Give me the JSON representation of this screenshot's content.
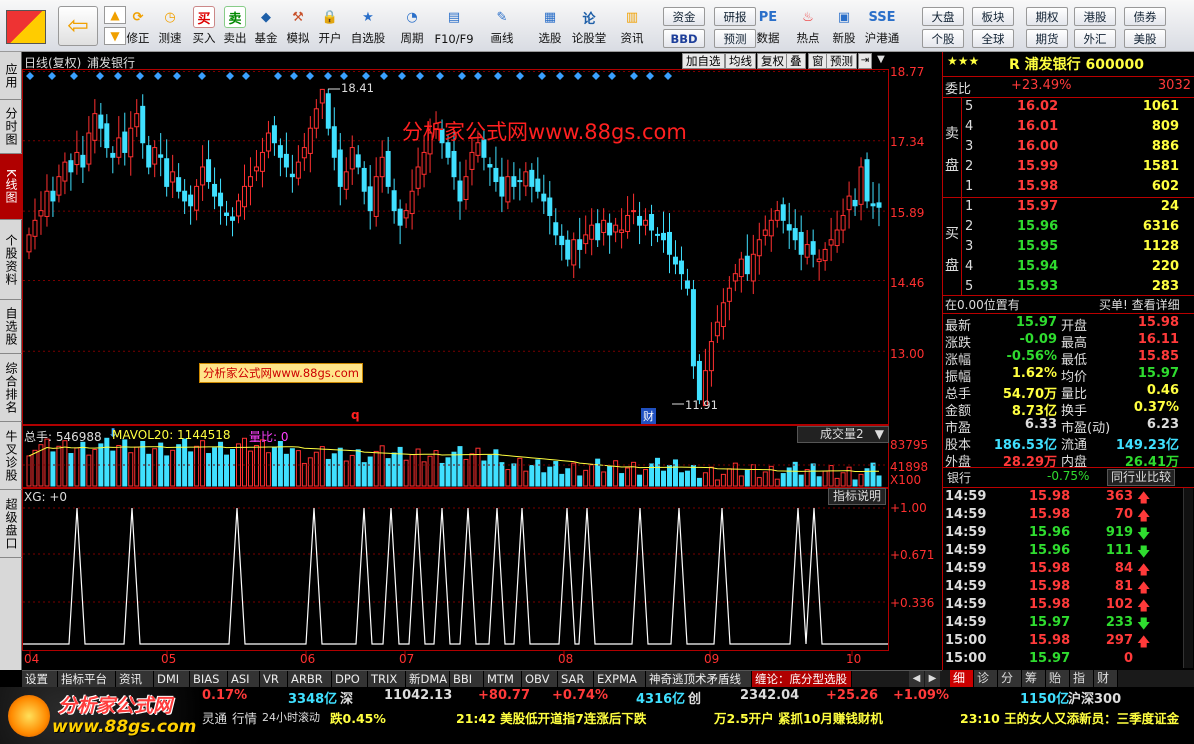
{
  "toolbar": {
    "buttons": [
      {
        "label": "修正"
      },
      {
        "label": "测速"
      },
      {
        "label": "买入"
      },
      {
        "label": "卖出"
      },
      {
        "label": "基金"
      },
      {
        "label": "模拟"
      },
      {
        "label": "开户"
      },
      {
        "label": "自选股"
      },
      {
        "label": "周期"
      },
      {
        "label": "F10/F9"
      },
      {
        "label": "画线"
      },
      {
        "label": "选股"
      },
      {
        "label": "论股堂"
      },
      {
        "label": "资讯"
      },
      {
        "label": "数据"
      },
      {
        "label": "热点"
      },
      {
        "label": "新股"
      },
      {
        "label": "沪港通"
      }
    ],
    "small": [
      {
        "label": "资金"
      },
      {
        "label": "BBD"
      },
      {
        "label": "研报"
      },
      {
        "label": "预测"
      },
      {
        "label": "大盘"
      },
      {
        "label": "个股"
      },
      {
        "label": "板块"
      },
      {
        "label": "全球"
      },
      {
        "label": "期权"
      },
      {
        "label": "期货"
      },
      {
        "label": "港股"
      },
      {
        "label": "外汇"
      },
      {
        "label": "债券"
      },
      {
        "label": "美股"
      }
    ],
    "icon_glyphs": {
      "buy": "买",
      "sell": "卖",
      "lun": "论"
    }
  },
  "left_tabs": [
    "应用",
    "分时图",
    "K线图",
    "个股资料",
    "自选股",
    "综合排名",
    "牛叉诊股",
    "超级盘口"
  ],
  "chart": {
    "header": {
      "period": "日线(复权)",
      "name": "浦发银行"
    },
    "buttons": [
      "加自选",
      "均线",
      "复权",
      "叠",
      "窗",
      "预测"
    ],
    "watermark": "分析家公式网www.88gs.com",
    "watermark2": "分析家公式网www.88gs.com",
    "y_ticks": [
      "18.77",
      "17.34",
      "15.89",
      "14.46",
      "13.00"
    ],
    "high_label": "18.41",
    "low_label": "11.91",
    "marker_q": "q",
    "marker_cai": "财",
    "vol_header": {
      "label": "总手: 546988",
      "ma": "MAVOL20: 1144518",
      "lb": "量比: 0"
    },
    "vol_dropdown": "成交量2",
    "vol_ticks": [
      "83795",
      "41898",
      "X100"
    ],
    "xg_header": "XG: +0",
    "xg_button": "指标说明",
    "xg_ticks": [
      "+1.00",
      "+0.671",
      "+0.336"
    ],
    "x_ticks": [
      "04",
      "05",
      "06",
      "07",
      "08",
      "09",
      "10"
    ]
  },
  "chart_data": {
    "type": "candlestick",
    "title": "浦发银行 日线(复权)",
    "ylim": [
      11.5,
      18.8
    ],
    "closes": [
      15.4,
      15.7,
      15.9,
      16.3,
      16.1,
      16.6,
      16.9,
      16.7,
      17.1,
      16.8,
      17.5,
      17.9,
      17.6,
      17.2,
      17.0,
      17.4,
      17.1,
      17.6,
      17.9,
      17.3,
      16.8,
      17.2,
      17.0,
      16.4,
      16.7,
      16.3,
      16.1,
      16.0,
      16.4,
      16.8,
      16.5,
      16.2,
      16.0,
      15.8,
      15.7,
      16.1,
      16.4,
      16.6,
      16.8,
      17.1,
      17.5,
      17.3,
      17.0,
      16.8,
      16.6,
      16.9,
      17.2,
      17.6,
      18.0,
      18.4,
      17.6,
      17.0,
      16.4,
      16.7,
      17.2,
      16.8,
      16.3,
      15.9,
      16.6,
      17.0,
      16.4,
      15.9,
      15.6,
      15.9,
      16.3,
      16.8,
      17.1,
      17.5,
      17.7,
      17.3,
      17.0,
      16.6,
      16.1,
      16.6,
      17.1,
      17.3,
      17.0,
      16.8,
      16.5,
      16.2,
      16.6,
      16.4,
      16.5,
      16.7,
      16.4,
      16.3,
      16.1,
      15.8,
      15.4,
      15.2,
      14.9,
      15.3,
      15.1,
      15.4,
      15.6,
      15.3,
      15.7,
      15.4,
      15.6,
      15.5,
      15.8,
      15.9,
      15.6,
      15.7,
      15.5,
      15.4,
      15.3,
      15.0,
      14.8,
      14.6,
      14.3,
      12.7,
      12.0,
      12.6,
      13.2,
      13.6,
      14.0,
      14.3,
      14.6,
      14.9,
      14.6,
      15.0,
      15.3,
      15.5,
      15.7,
      15.9,
      15.7,
      15.5,
      15.3,
      15.0,
      15.2,
      15.0,
      14.9,
      15.1,
      15.3,
      15.5,
      15.8,
      16.2,
      16.0,
      16.8,
      16.1,
      16.0,
      15.97
    ],
    "high": 18.41,
    "low": 11.91,
    "volume_axis": [
      0,
      83795
    ],
    "xg_signal_axis": [
      0,
      1.0
    ]
  },
  "quote": {
    "stars": "★★★",
    "title": "R 浦发银行 600000",
    "weibi_label": "委比",
    "weibi": "+23.49%",
    "weicha": "3032",
    "sell_label": "卖盘",
    "buy_label": "买盘",
    "asks": [
      {
        "lvl": "5",
        "price": "16.02",
        "vol": "1061"
      },
      {
        "lvl": "4",
        "price": "16.01",
        "vol": "809"
      },
      {
        "lvl": "3",
        "price": "16.00",
        "vol": "886"
      },
      {
        "lvl": "2",
        "price": "15.99",
        "vol": "1581"
      },
      {
        "lvl": "1",
        "price": "15.98",
        "vol": "602"
      }
    ],
    "bids": [
      {
        "lvl": "1",
        "price": "15.97",
        "vol": "24"
      },
      {
        "lvl": "2",
        "price": "15.96",
        "vol": "6316"
      },
      {
        "lvl": "3",
        "price": "15.95",
        "vol": "1128"
      },
      {
        "lvl": "4",
        "price": "15.94",
        "vol": "220"
      },
      {
        "lvl": "5",
        "price": "15.93",
        "vol": "283"
      }
    ],
    "pos_text": "在0.00位置有",
    "buy_detail": "买单! 查看详细",
    "stats": [
      [
        "最新",
        "15.97",
        "开盘",
        "15.98"
      ],
      [
        "涨跌",
        "-0.09",
        "最高",
        "16.11"
      ],
      [
        "涨幅",
        "-0.56%",
        "最低",
        "15.85"
      ],
      [
        "振幅",
        "1.62%",
        "均价",
        "15.97"
      ],
      [
        "总手",
        "54.70万",
        "量比",
        "0.46"
      ],
      [
        "金额",
        "8.73亿",
        "换手",
        "0.37%"
      ],
      [
        "市盈",
        "6.33",
        "市盈(动)",
        "6.23"
      ],
      [
        "股本",
        "186.53亿",
        "流通",
        "149.23亿"
      ],
      [
        "外盘",
        "28.29万",
        "内盘",
        "26.41万"
      ]
    ],
    "industry": {
      "name": "银行",
      "chg": "-0.75%",
      "btn": "同行业比较"
    },
    "ticks": [
      [
        "14:59",
        "15.98",
        "363",
        "up"
      ],
      [
        "14:59",
        "15.98",
        "70",
        "up"
      ],
      [
        "14:59",
        "15.96",
        "919",
        "down"
      ],
      [
        "14:59",
        "15.96",
        "111",
        "down"
      ],
      [
        "14:59",
        "15.98",
        "84",
        "up"
      ],
      [
        "14:59",
        "15.98",
        "81",
        "up"
      ],
      [
        "14:59",
        "15.98",
        "102",
        "up"
      ],
      [
        "14:59",
        "15.97",
        "233",
        "down"
      ],
      [
        "15:00",
        "15.98",
        "297",
        "up"
      ],
      [
        "15:00",
        "15.97",
        "0",
        "none"
      ]
    ]
  },
  "bottom_tabs": [
    "设置",
    "指标平台",
    "资讯",
    "DMI",
    "BIAS",
    "ASI",
    "VR",
    "ARBR",
    "DPO",
    "TRIX",
    "新DMA",
    "BBI",
    "MTM",
    "OBV",
    "SAR",
    "EXPMA",
    "神奇逃顶术矛盾线",
    "缠论：底分型选股"
  ],
  "right_bottom_tabs": [
    "细",
    "诊",
    "分",
    "筹",
    "贻",
    "指",
    "财"
  ],
  "status": {
    "s1": "0.17%",
    "s2": "3348亿",
    "s3": "深",
    "s4": "11042.13",
    "s5": "+80.77",
    "s6": "+0.74%",
    "s7": "4316亿",
    "s8": "创",
    "s9": "2342.04",
    "s10": "+25.26",
    "s11": "+1.09%",
    "s12": "1150亿",
    "s13": "沪深300"
  },
  "ticker": {
    "t1": "灵通",
    "t2": "行情",
    "t3": "24小时滚动",
    "t4": "跌0.45%",
    "t5": "21:42 美股低开道指7连涨后下跌",
    "t6": "万2.5开户 紧抓10月赚钱财机",
    "t7": "23:10 王的女人又添新员：三季度证金"
  },
  "logo": {
    "title": "分析家公式网",
    "url": "www.88gs.com"
  }
}
